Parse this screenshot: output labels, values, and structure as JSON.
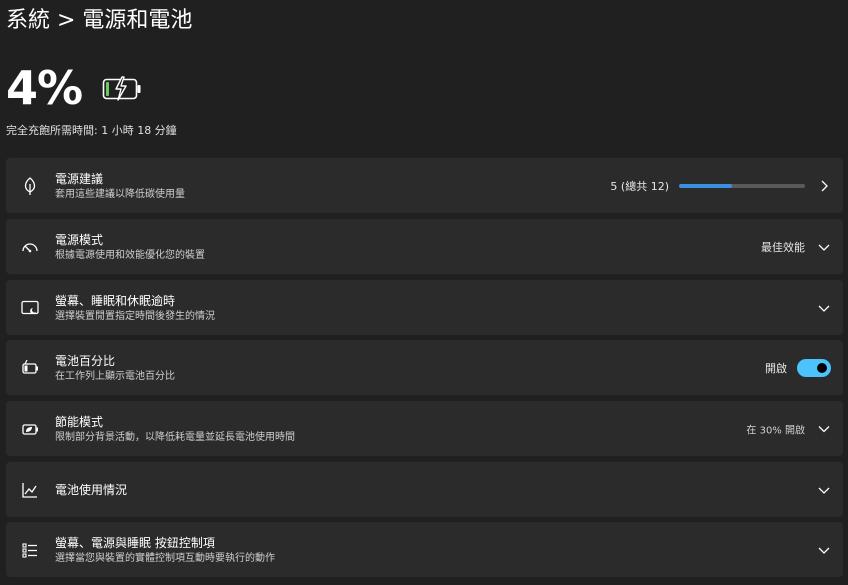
{
  "header": {
    "breadcrumb": "系統 > 電源和電池"
  },
  "battery": {
    "percent_label": "4%",
    "percent": 4,
    "charging": true,
    "time_to_full": "完全充飽所需時間: 1 小時 18 分鐘"
  },
  "cards": {
    "power_recommendations": {
      "icon": "leaf-icon",
      "title": "電源建議",
      "desc": "套用這些建議以降低碳使用量",
      "value": "5 (總共 12)",
      "progress": 0.42
    },
    "power_mode": {
      "icon": "speedometer-icon",
      "title": "電源模式",
      "desc": "根據電源使用和效能優化您的裝置",
      "value": "最佳效能"
    },
    "screen_sleep": {
      "icon": "screen-sleep-icon",
      "title": "螢幕、睡眠和休眠逾時",
      "desc": "選擇裝置閒置指定時間後發生的情況"
    },
    "battery_percentage": {
      "icon": "battery-charging-icon",
      "title": "電池百分比",
      "desc": "在工作列上顯示電池百分比",
      "value": "開啟",
      "toggle_on": true
    },
    "energy_saver": {
      "icon": "energy-saver-icon",
      "title": "節能模式",
      "desc": "限制部分背景活動，以降低耗電量並延長電池使用時間",
      "value": "在 30% 開啟"
    },
    "battery_usage": {
      "icon": "chart-icon",
      "title": "電池使用情況"
    },
    "lid_buttons": {
      "icon": "list-icon",
      "title": "螢幕、電源與睡眠 按鈕控制項",
      "desc": "選擇當您與裝置的實體控制項互動時要執行的動作"
    }
  },
  "colors": {
    "background": "#202020",
    "card": "#2b2b2b",
    "accent": "#4cc2ff",
    "progress_fill": "#3b8fe0",
    "battery_fill": "#6ccb5f"
  }
}
